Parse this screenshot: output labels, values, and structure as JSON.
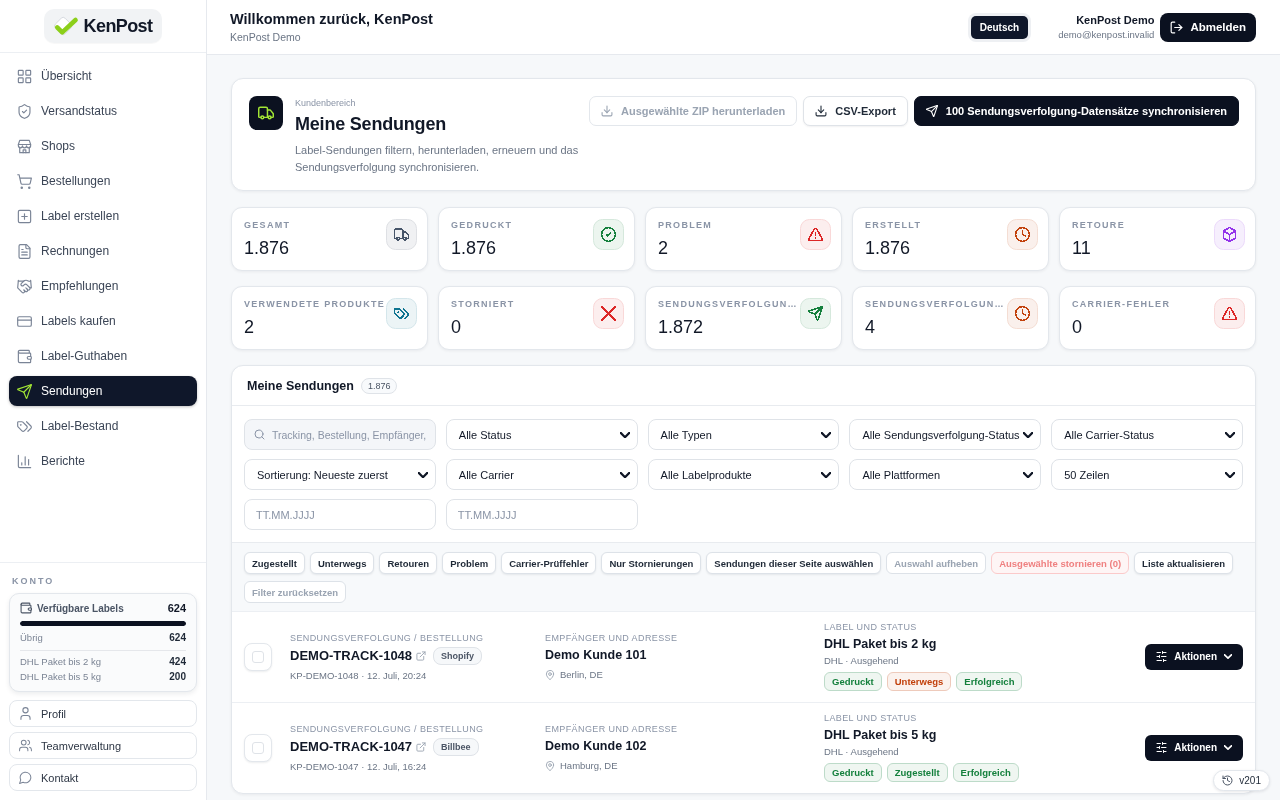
{
  "sidebar": {
    "logo": "KenPost",
    "items": [
      {
        "label": "Übersicht",
        "selected": false
      },
      {
        "label": "Versandstatus",
        "selected": false
      },
      {
        "label": "Shops",
        "selected": false
      },
      {
        "label": "Bestellungen",
        "selected": false
      },
      {
        "label": "Label erstellen",
        "selected": false
      },
      {
        "label": "Rechnungen",
        "selected": false
      },
      {
        "label": "Empfehlungen",
        "selected": false
      },
      {
        "label": "Labels kaufen",
        "selected": false
      },
      {
        "label": "Label-Guthaben",
        "selected": false
      },
      {
        "label": "Sendungen",
        "selected": true
      },
      {
        "label": "Label-Bestand",
        "selected": false
      },
      {
        "label": "Berichte",
        "selected": false
      }
    ],
    "account": {
      "heading": "KONTO",
      "credits": {
        "label": "Verfügbare Labels",
        "value": "624",
        "level": 1,
        "remaining_label": "Übrig",
        "remaining_value": "624",
        "products": [
          {
            "name": "DHL Paket bis 2 kg",
            "count": "424"
          },
          {
            "name": "DHL Paket bis 5 kg",
            "count": "200"
          }
        ]
      },
      "links": [
        "Profil",
        "Teamverwaltung",
        "Kontakt"
      ]
    }
  },
  "header": {
    "title": "Willkommen zurück, KenPost",
    "subtitle": "KenPost Demo",
    "language": "Deutsch",
    "user_name": "KenPost Demo",
    "user_email": "demo@kenpost.invalid",
    "logout": "Abmelden"
  },
  "hero": {
    "eyebrow": "Kundenbereich",
    "title": "Meine Sendungen",
    "description": "Label-Sendungen filtern, herunterladen, erneuern und das Sendungsverfolgung synchronisieren.",
    "actions": [
      {
        "label": "Ausgewählte ZIP herunterladen",
        "kind": "outline",
        "disabled": true
      },
      {
        "label": "CSV-Export",
        "kind": "outline",
        "disabled": false
      },
      {
        "label": "100 Sendungsverfolgung-Datensätze synchronisieren",
        "kind": "primary",
        "disabled": false
      }
    ]
  },
  "stats": [
    {
      "label": "GESAMT",
      "value": "1.876",
      "color": "#475569"
    },
    {
      "label": "GEDRUCKT",
      "value": "1.876",
      "color": "#15803d"
    },
    {
      "label": "PROBLEM",
      "value": "2",
      "color": "#dc2626"
    },
    {
      "label": "ERSTELLT",
      "value": "1.876",
      "color": "#c2410c"
    },
    {
      "label": "RETOURE",
      "value": "11",
      "color": "#9333ea"
    },
    {
      "label": "VERWENDETE PRODUKTE",
      "value": "2",
      "color": "#0e7490"
    },
    {
      "label": "STORNIERT",
      "value": "0",
      "color": "#dc2626"
    },
    {
      "label": "SENDUNGSVERFOLGUN…",
      "value": "1.872",
      "color": "#15803d"
    },
    {
      "label": "SENDUNGSVERFOLGUN…",
      "value": "4",
      "color": "#c2410c"
    },
    {
      "label": "CARRIER-FEHLER",
      "value": "0",
      "color": "#dc2626"
    }
  ],
  "shipments": {
    "title": "Meine Sendungen",
    "count": "1.876",
    "search": {
      "placeholder": "Tracking, Bestellung, Empfänger,"
    },
    "selects": [
      "Alle Status",
      "Alle Typen",
      "Alle Sendungsverfolgung-Status",
      "Alle Carrier-Status",
      "Sortierung: Neueste zuerst",
      "Alle Carrier",
      "Alle Labelprodukte",
      "Alle Plattformen",
      "50 Zeilen"
    ],
    "date_fields": [
      {
        "placeholder": "TT.MM.JJJJ"
      },
      {
        "placeholder": "TT.MM.JJJJ"
      }
    ],
    "quick_filters": [
      {
        "label": "Zugestellt",
        "kind": "default",
        "disabled": false
      },
      {
        "label": "Unterwegs",
        "kind": "default",
        "disabled": false
      },
      {
        "label": "Retouren",
        "kind": "default",
        "disabled": false
      },
      {
        "label": "Problem",
        "kind": "default",
        "disabled": false
      },
      {
        "label": "Carrier-Prüffehler",
        "kind": "default",
        "disabled": false
      },
      {
        "label": "Nur Stornierungen",
        "kind": "default",
        "disabled": false
      },
      {
        "label": "Sendungen dieser Seite auswählen",
        "kind": "default",
        "disabled": false
      },
      {
        "label": "Auswahl aufheben",
        "kind": "default",
        "disabled": true
      },
      {
        "label": "Ausgewählte stornieren (0)",
        "kind": "danger",
        "disabled": true
      },
      {
        "label": "Liste aktualisieren",
        "kind": "default",
        "disabled": false
      },
      {
        "label": "Filter zurücksetzen",
        "kind": "default",
        "disabled": true
      }
    ],
    "rows": [
      {
        "checked": false,
        "tracking_label": "SENDUNGSVERFOLGUNG / BESTELLUNG",
        "tracking": "DEMO-TRACK-1048",
        "platform": "Shopify",
        "meta": "KP-DEMO-1048 · 12. Juli, 20:24",
        "recipient_label": "EMPFÄNGER UND ADRESSE",
        "recipient": "Demo Kunde 101",
        "location": "Berlin, DE",
        "status_label": "LABEL UND STATUS",
        "product": "DHL Paket bis 2 kg",
        "carrier": "DHL · Ausgehend",
        "tags": [
          {
            "label": "Gedruckt",
            "color": "#15803d"
          },
          {
            "label": "Unterwegs",
            "color": "#c2410c"
          },
          {
            "label": "Erfolgreich",
            "color": "#15803d"
          }
        ],
        "action": "Aktionen"
      },
      {
        "checked": false,
        "tracking_label": "SENDUNGSVERFOLGUNG / BESTELLUNG",
        "tracking": "DEMO-TRACK-1047",
        "platform": "Billbee",
        "meta": "KP-DEMO-1047 · 12. Juli, 16:24",
        "recipient_label": "EMPFÄNGER UND ADRESSE",
        "recipient": "Demo Kunde 102",
        "location": "Hamburg, DE",
        "status_label": "LABEL UND STATUS",
        "product": "DHL Paket bis 5 kg",
        "carrier": "DHL · Ausgehend",
        "tags": [
          {
            "label": "Gedruckt",
            "color": "#15803d"
          },
          {
            "label": "Zugestellt",
            "color": "#15803d"
          },
          {
            "label": "Erfolgreich",
            "color": "#15803d"
          }
        ],
        "action": "Aktionen"
      }
    ]
  },
  "version": "v201"
}
